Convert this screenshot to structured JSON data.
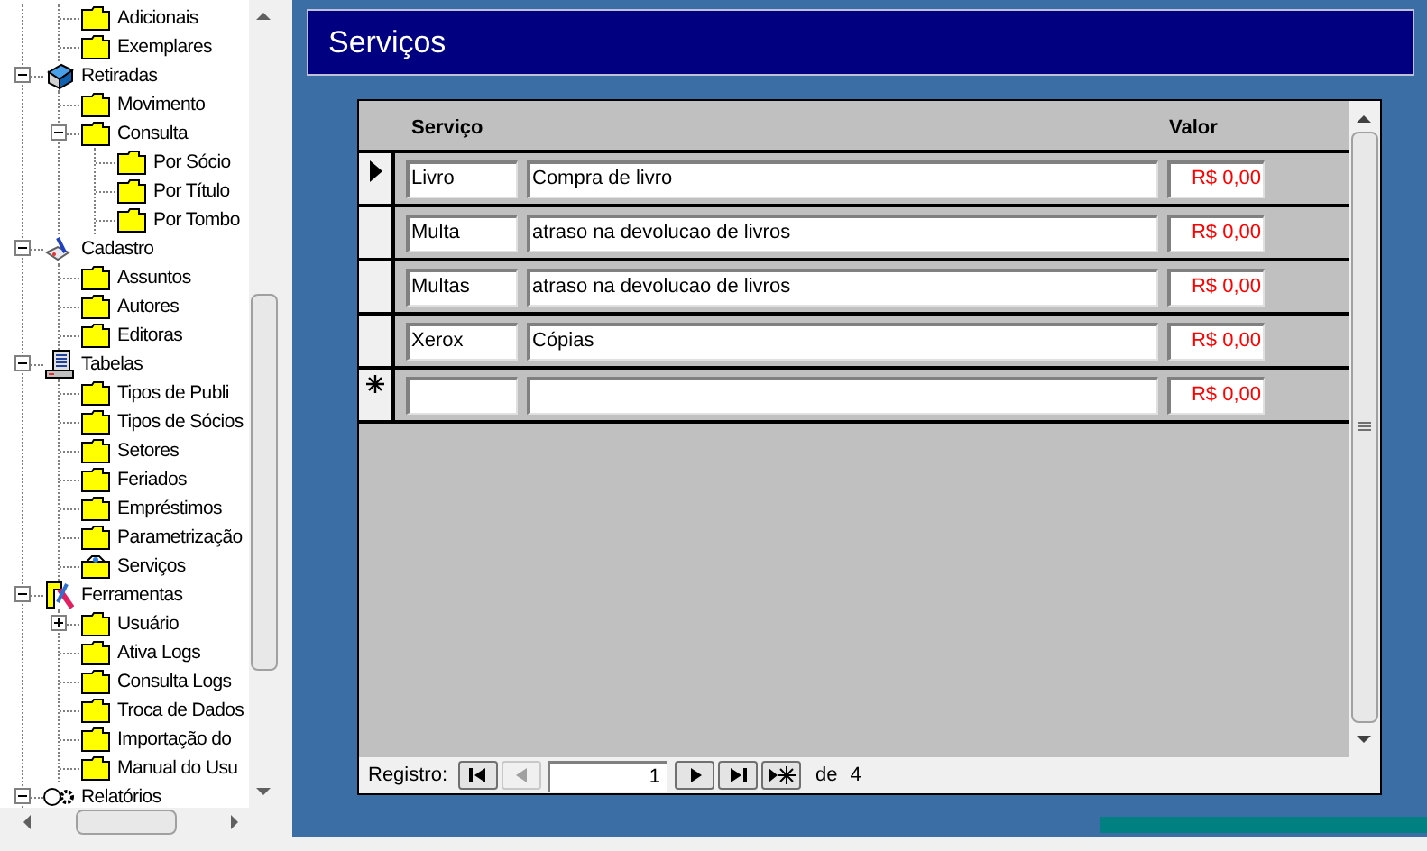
{
  "window": {
    "title": "Serviços"
  },
  "tree": {
    "continued_items": [
      {
        "label": "Adicionais",
        "kind": "folder"
      },
      {
        "label": "Exemplares",
        "kind": "folder"
      }
    ],
    "nodes": [
      {
        "label": "Retiradas",
        "kind": "book",
        "expanded": true,
        "children": [
          {
            "label": "Movimento",
            "kind": "folder"
          },
          {
            "label": "Consulta",
            "kind": "folder",
            "expanded": true,
            "children": [
              {
                "label": "Por Sócio",
                "kind": "folder"
              },
              {
                "label": "Por Título",
                "kind": "folder"
              },
              {
                "label": "Por Tombo",
                "kind": "folder"
              }
            ]
          }
        ]
      },
      {
        "label": "Cadastro",
        "kind": "pen",
        "expanded": true,
        "children": [
          {
            "label": "Assuntos",
            "kind": "folder"
          },
          {
            "label": "Autores",
            "kind": "folder"
          },
          {
            "label": "Editoras",
            "kind": "folder"
          }
        ]
      },
      {
        "label": "Tabelas",
        "kind": "computer",
        "expanded": true,
        "children": [
          {
            "label": "Tipos de Publi",
            "kind": "folder"
          },
          {
            "label": "Tipos de Sócios",
            "kind": "folder"
          },
          {
            "label": "Setores",
            "kind": "folder"
          },
          {
            "label": "Feriados",
            "kind": "folder"
          },
          {
            "label": "Empréstimos",
            "kind": "folder"
          },
          {
            "label": "Parametrização",
            "kind": "folder"
          },
          {
            "label": "Serviços",
            "kind": "open-folder"
          }
        ]
      },
      {
        "label": "Ferramentas",
        "kind": "tools",
        "expanded": true,
        "children": [
          {
            "label": "Usuário",
            "kind": "folder",
            "expanded": false
          },
          {
            "label": "Ativa Logs",
            "kind": "folder"
          },
          {
            "label": "Consulta Logs",
            "kind": "folder"
          },
          {
            "label": "Troca de Dados",
            "kind": "folder"
          },
          {
            "label": "Importação do",
            "kind": "folder"
          },
          {
            "label": "Manual do Usu",
            "kind": "folder"
          }
        ]
      },
      {
        "label": "Relatórios",
        "kind": "gear",
        "expanded": true
      }
    ]
  },
  "form": {
    "columns": [
      "Serviço",
      "Valor"
    ],
    "rows": [
      {
        "selected": true,
        "servico": "Livro",
        "descricao": "Compra de livro",
        "valor": "R$ 0,00"
      },
      {
        "selected": false,
        "servico": "Multa",
        "descricao": "atraso na devolucao de livros",
        "valor": "R$ 0,00"
      },
      {
        "selected": false,
        "servico": "Multas",
        "descricao": "atraso na devolucao de livros",
        "valor": "R$ 0,00"
      },
      {
        "selected": false,
        "servico": "Xerox",
        "descricao": "Cópias",
        "valor": "R$ 0,00"
      }
    ],
    "new_row": {
      "valor": "R$ 0,00"
    }
  },
  "navigator": {
    "label": "Registro:",
    "current": "1",
    "of_label": "de",
    "total": "4",
    "buttons_before": [
      {
        "kind": "first",
        "disabled": false
      },
      {
        "kind": "previous",
        "disabled": true
      }
    ],
    "buttons_after": [
      {
        "kind": "next",
        "disabled": false
      },
      {
        "kind": "last",
        "disabled": false
      },
      {
        "kind": "new",
        "disabled": false
      }
    ]
  }
}
